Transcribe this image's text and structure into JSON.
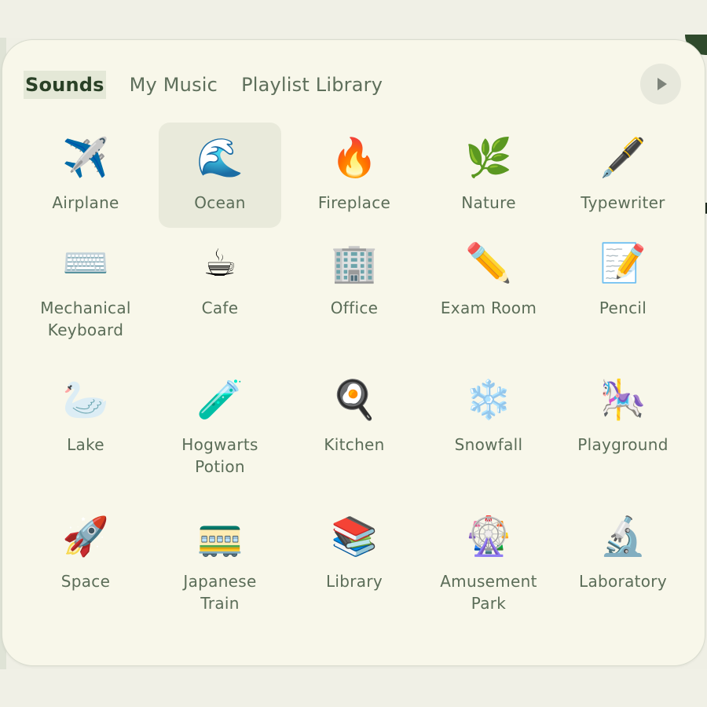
{
  "tabs": [
    {
      "label": "Sounds",
      "active": true
    },
    {
      "label": "My Music",
      "active": false
    },
    {
      "label": "Playlist Library",
      "active": false
    }
  ],
  "play_button": {
    "icon": "play-icon"
  },
  "sounds": [
    {
      "label": "Airplane",
      "icon": "✈️",
      "icon_name": "airplane-icon",
      "selected": false
    },
    {
      "label": "Ocean",
      "icon": "🌊",
      "icon_name": "wave-icon",
      "selected": true
    },
    {
      "label": "Fireplace",
      "icon": "🔥",
      "icon_name": "fire-icon",
      "selected": false
    },
    {
      "label": "Nature",
      "icon": "🌿",
      "icon_name": "herb-icon",
      "selected": false
    },
    {
      "label": "Typewriter",
      "icon": "🖋️",
      "icon_name": "fountain-pen-icon",
      "selected": false
    },
    {
      "label": "Mechanical\nKeyboard",
      "icon": "⌨️",
      "icon_name": "keyboard-icon",
      "selected": false
    },
    {
      "label": "Cafe",
      "icon": "☕",
      "icon_name": "coffee-icon",
      "selected": false
    },
    {
      "label": "Office",
      "icon": "🏢",
      "icon_name": "office-building-icon",
      "selected": false
    },
    {
      "label": "Exam Room",
      "icon": "✏️",
      "icon_name": "pencil-icon",
      "selected": false
    },
    {
      "label": "Pencil",
      "icon": "📝",
      "icon_name": "memo-icon",
      "selected": false
    },
    {
      "label": "Lake",
      "icon": "🦢",
      "icon_name": "swan-icon",
      "selected": false
    },
    {
      "label": "Hogwarts\nPotion",
      "icon": "🧪",
      "icon_name": "test-tube-icon",
      "selected": false
    },
    {
      "label": "Kitchen",
      "icon": "🍳",
      "icon_name": "frying-pan-icon",
      "selected": false
    },
    {
      "label": "Snowfall",
      "icon": "❄️",
      "icon_name": "snowflake-icon",
      "selected": false
    },
    {
      "label": "Playground",
      "icon": "🎠",
      "icon_name": "carousel-horse-icon",
      "selected": false
    },
    {
      "label": "Space",
      "icon": "🚀",
      "icon_name": "rocket-icon",
      "selected": false
    },
    {
      "label": "Japanese\nTrain",
      "icon": "🚃",
      "icon_name": "train-icon",
      "selected": false
    },
    {
      "label": "Library",
      "icon": "📚",
      "icon_name": "books-icon",
      "selected": false
    },
    {
      "label": "Amusement\nPark",
      "icon": "🎡",
      "icon_name": "ferris-wheel-icon",
      "selected": false
    },
    {
      "label": "Laboratory",
      "icon": "🔬",
      "icon_name": "microscope-icon",
      "selected": false
    }
  ]
}
